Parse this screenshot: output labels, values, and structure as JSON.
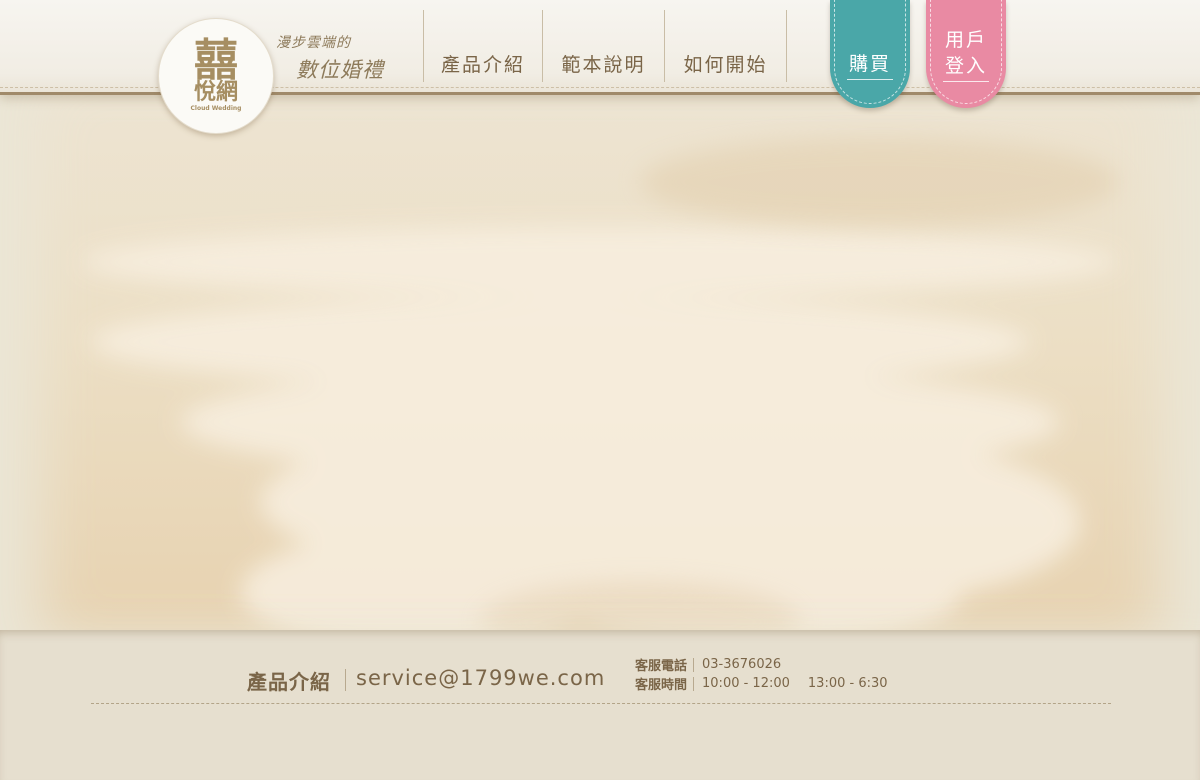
{
  "logo": {
    "glyph": "囍",
    "name": "悅網",
    "subtitle": "Cloud Wedding"
  },
  "tagline": {
    "line1": "漫步雲端的",
    "line2": "數位婚禮"
  },
  "nav": {
    "items": [
      {
        "label": "產品介紹"
      },
      {
        "label": "範本說明"
      },
      {
        "label": "如何開始"
      }
    ]
  },
  "buttons": {
    "buy": "購買",
    "login_line1": "用戶",
    "login_line2": "登入",
    "buy_color": "#4aa7a8",
    "login_color": "#e98aa3"
  },
  "footer": {
    "title": "產品介紹",
    "email": "service@1799we.com",
    "phone_label": "客服電話",
    "phone": "03-3676026",
    "hours_label": "客服時間",
    "hours1": "10:00 - 12:00",
    "hours2": "13:00 - 6:30"
  },
  "colors": {
    "brand_gold": "#a68e62",
    "text_brown": "#7a6548",
    "background": "#e8e0cf"
  }
}
